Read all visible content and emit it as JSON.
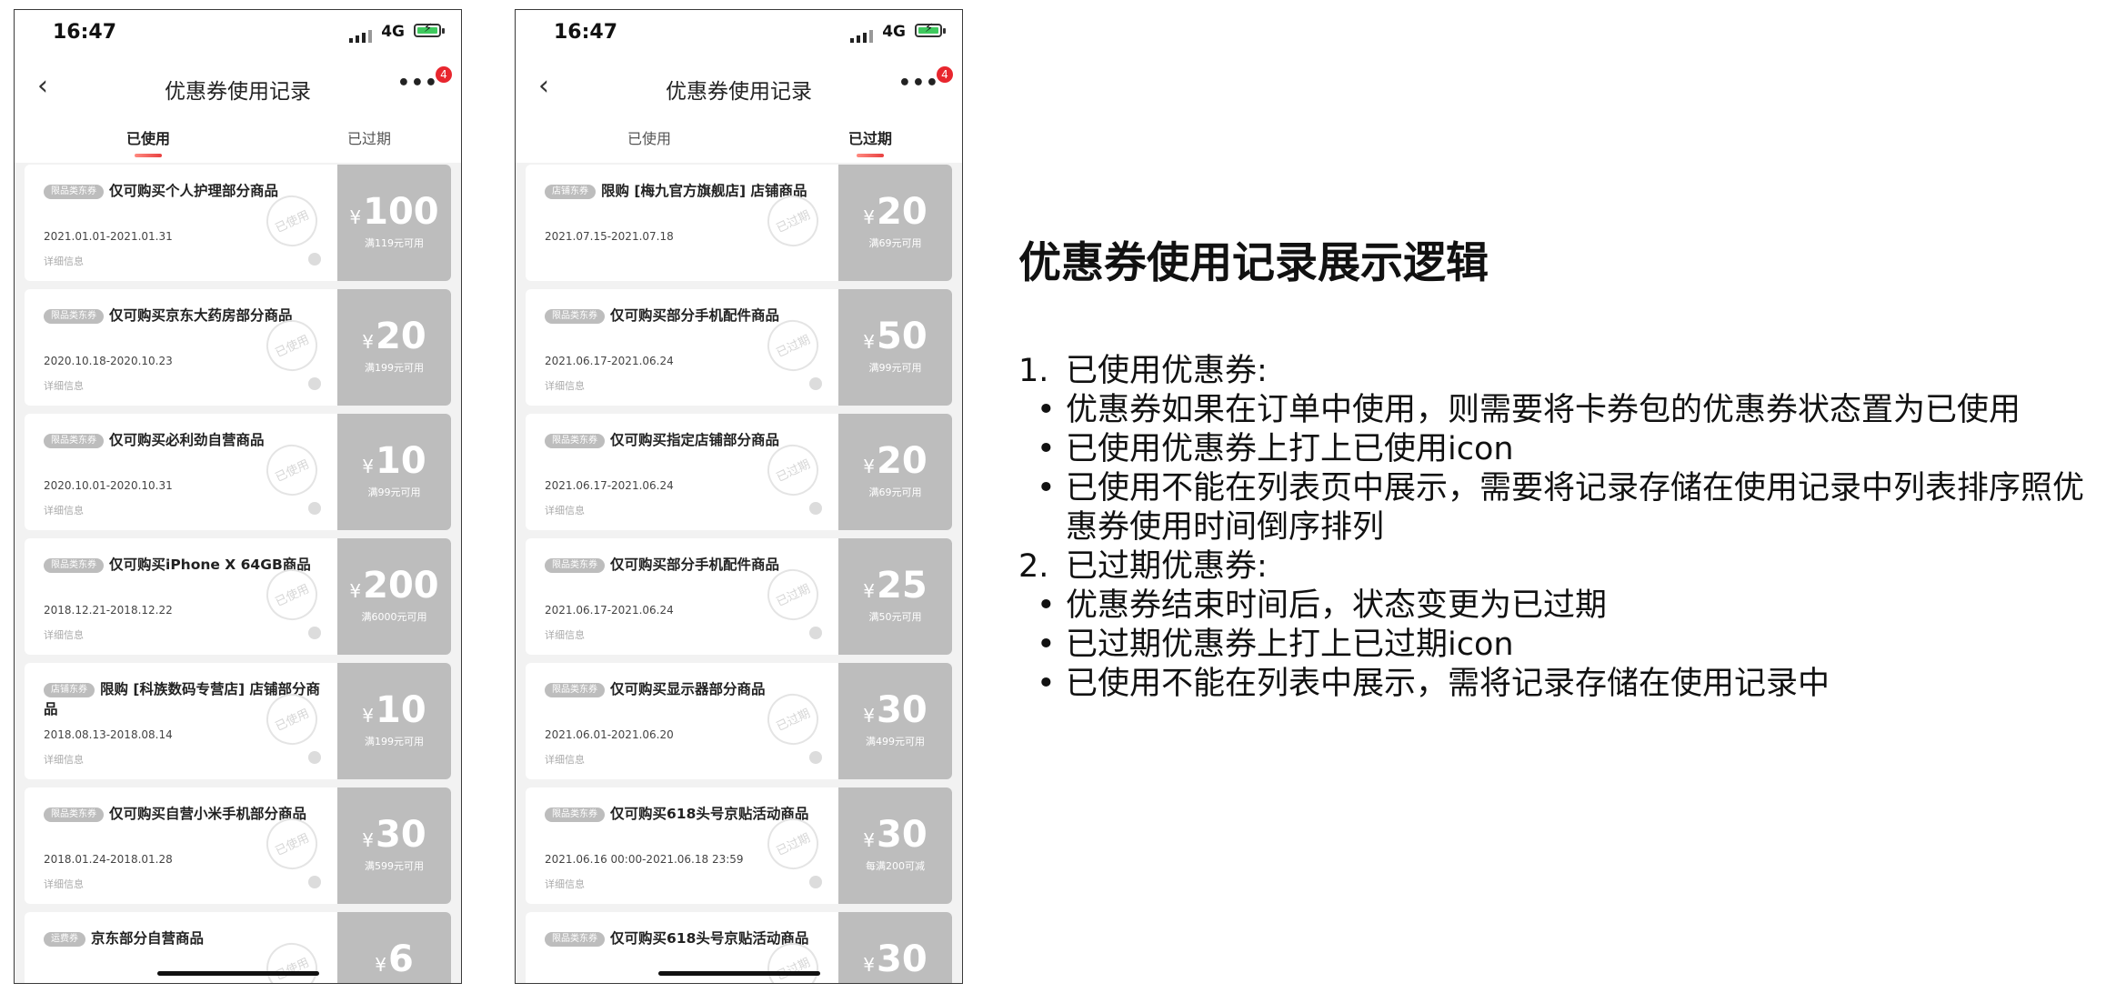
{
  "phones": [
    {
      "status": {
        "time": "16:47",
        "network": "4G"
      },
      "nav": {
        "back_icon": "chevron-left",
        "title": "优惠券使用记录",
        "more_icon": "more-dots",
        "badge": "4"
      },
      "tabs": [
        {
          "label": "已使用",
          "active": true
        },
        {
          "label": "已过期",
          "active": false
        }
      ],
      "stamp_text": "已使用",
      "coupons": [
        {
          "tag": "限品类东券",
          "title": "仅可购买个人护理部分商品",
          "dates": "2021.01.01-2021.01.31",
          "detail": "详细信息",
          "currency": "¥",
          "amount": "100",
          "condition": "满119元可用"
        },
        {
          "tag": "限品类东券",
          "title": "仅可购买京东大药房部分商品",
          "dates": "2020.10.18-2020.10.23",
          "detail": "详细信息",
          "currency": "¥",
          "amount": "20",
          "condition": "满199元可用"
        },
        {
          "tag": "限品类东券",
          "title": "仅可购买必利劲自营商品",
          "dates": "2020.10.01-2020.10.31",
          "detail": "详细信息",
          "currency": "¥",
          "amount": "10",
          "condition": "满99元可用"
        },
        {
          "tag": "限品类东券",
          "title": "仅可购买iPhone X 64GB商品",
          "dates": "2018.12.21-2018.12.22",
          "detail": "详细信息",
          "currency": "¥",
          "amount": "200",
          "condition": "满6000元可用"
        },
        {
          "tag": "店铺东券",
          "title": "限购 [科族数码专营店] 店铺部分商品",
          "dates": "2018.08.13-2018.08.14",
          "detail": "详细信息",
          "currency": "¥",
          "amount": "10",
          "condition": "满199元可用"
        },
        {
          "tag": "限品类东券",
          "title": "仅可购买自营小米手机部分商品",
          "dates": "2018.01.24-2018.01.28",
          "detail": "详细信息",
          "currency": "¥",
          "amount": "30",
          "condition": "满599元可用"
        },
        {
          "tag": "运费券",
          "title": "京东部分自营商品",
          "dates": "",
          "detail": "",
          "currency": "¥",
          "amount": "6",
          "condition": ""
        }
      ]
    },
    {
      "status": {
        "time": "16:47",
        "network": "4G"
      },
      "nav": {
        "back_icon": "chevron-left",
        "title": "优惠券使用记录",
        "more_icon": "more-dots",
        "badge": "4"
      },
      "tabs": [
        {
          "label": "已使用",
          "active": false
        },
        {
          "label": "已过期",
          "active": true
        }
      ],
      "stamp_text": "已过期",
      "coupons": [
        {
          "tag": "店铺东券",
          "title": "限购 [梅九官方旗舰店] 店铺商品",
          "dates": "2021.07.15-2021.07.18",
          "detail": "",
          "currency": "¥",
          "amount": "20",
          "condition": "满69元可用"
        },
        {
          "tag": "限品类东券",
          "title": "仅可购买部分手机配件商品",
          "dates": "2021.06.17-2021.06.24",
          "detail": "详细信息",
          "currency": "¥",
          "amount": "50",
          "condition": "满99元可用"
        },
        {
          "tag": "限品类东券",
          "title": "仅可购买指定店铺部分商品",
          "dates": "2021.06.17-2021.06.24",
          "detail": "详细信息",
          "currency": "¥",
          "amount": "20",
          "condition": "满69元可用"
        },
        {
          "tag": "限品类东券",
          "title": "仅可购买部分手机配件商品",
          "dates": "2021.06.17-2021.06.24",
          "detail": "详细信息",
          "currency": "¥",
          "amount": "25",
          "condition": "满50元可用"
        },
        {
          "tag": "限品类东券",
          "title": "仅可购买显示器部分商品",
          "dates": "2021.06.01-2021.06.20",
          "detail": "详细信息",
          "currency": "¥",
          "amount": "30",
          "condition": "满499元可用"
        },
        {
          "tag": "限品类东券",
          "title": "仅可购买618头号京贴活动商品",
          "dates": "2021.06.16 00:00-2021.06.18 23:59",
          "detail": "详细信息",
          "currency": "¥",
          "amount": "30",
          "condition": "每满200可减"
        },
        {
          "tag": "限品类东券",
          "title": "仅可购买618头号京贴活动商品",
          "dates": "",
          "detail": "",
          "currency": "¥",
          "amount": "30",
          "condition": ""
        }
      ]
    }
  ],
  "doc": {
    "title": "优惠券使用记录展示逻辑",
    "sections": [
      {
        "num": "1.",
        "heading": "已使用优惠券:",
        "bullets": [
          "优惠券如果在订单中使用，则需要将卡券包的优惠券状态置为已使用",
          "已使用优惠券上打上已使用icon",
          "已使用不能在列表页中展示，需要将记录存储在使用记录中列表排序照优惠券使用时间倒序排列"
        ]
      },
      {
        "num": "2.",
        "heading": "已过期优惠券:",
        "bullets": [
          "优惠券结束时间后，状态变更为已过期",
          "已过期优惠券上打上已过期icon",
          "已使用不能在列表中展示，需将记录存储在使用记录中"
        ]
      }
    ]
  }
}
